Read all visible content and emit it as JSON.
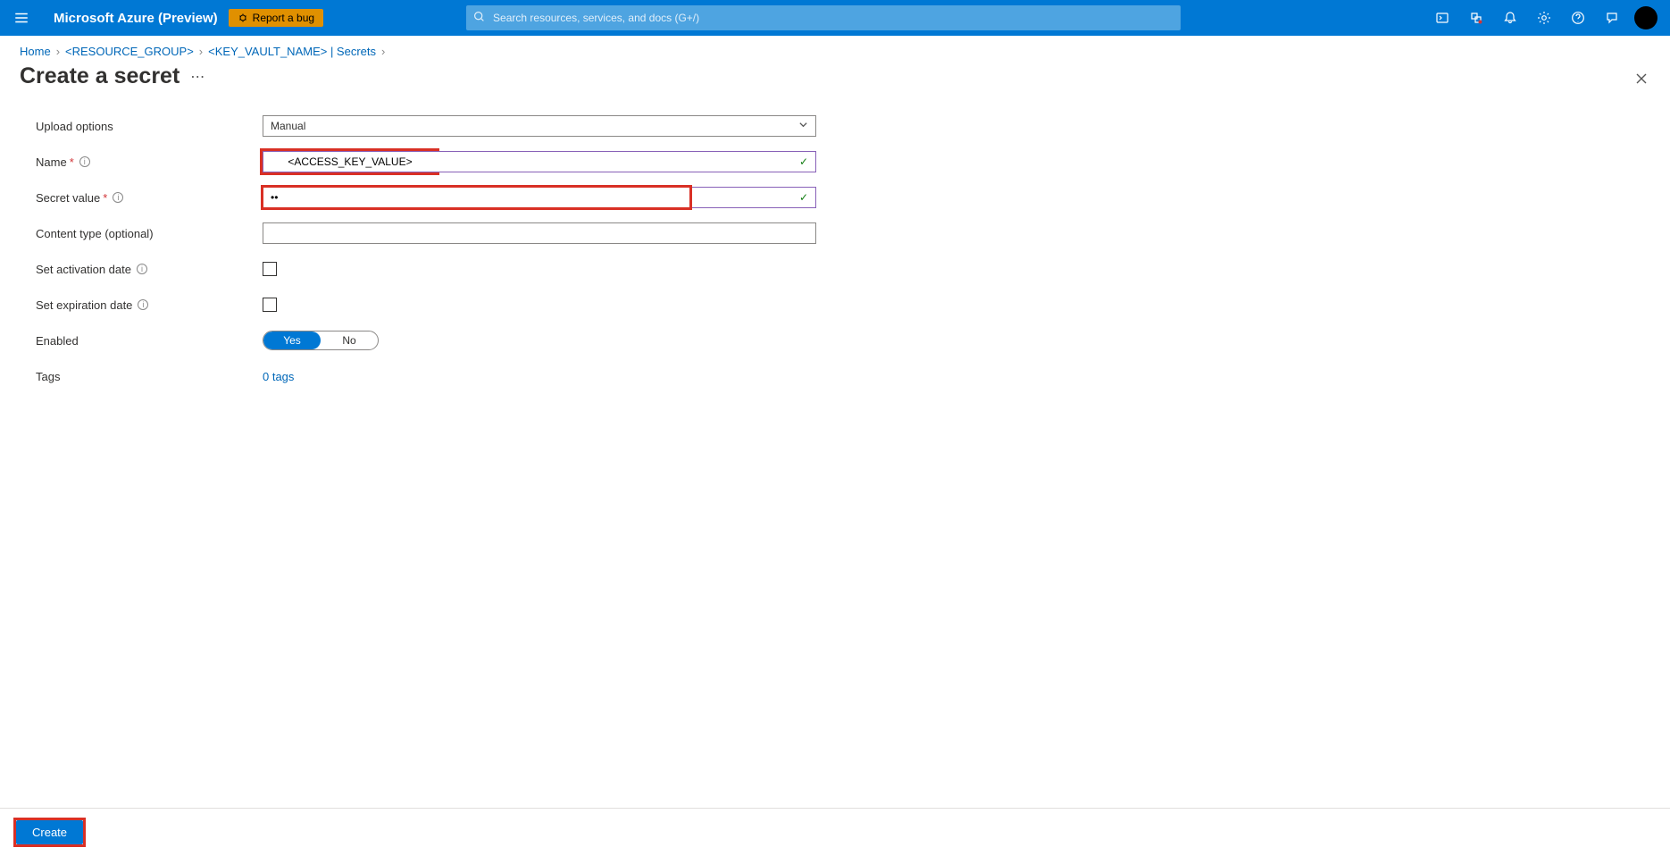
{
  "header": {
    "brand": "Microsoft Azure (Preview)",
    "report_bug": "Report a bug",
    "search_placeholder": "Search resources, services, and docs (G+/)"
  },
  "breadcrumbs": {
    "home": "Home",
    "resource_group": "<RESOURCE_GROUP>",
    "keyvault_secrets": "<KEY_VAULT_NAME> | Secrets"
  },
  "page": {
    "title": "Create a secret"
  },
  "form": {
    "upload_options_label": "Upload options",
    "upload_options_value": "Manual",
    "name_label": "Name",
    "name_value": "<ACCESS_KEY_VALUE>",
    "secret_value_label": "Secret value",
    "secret_value_masked": "••",
    "content_type_label": "Content type (optional)",
    "content_type_value": "",
    "activation_label": "Set activation date",
    "expiration_label": "Set expiration date",
    "enabled_label": "Enabled",
    "enabled_yes": "Yes",
    "enabled_no": "No",
    "tags_label": "Tags",
    "tags_link": "0 tags"
  },
  "footer": {
    "create": "Create"
  }
}
